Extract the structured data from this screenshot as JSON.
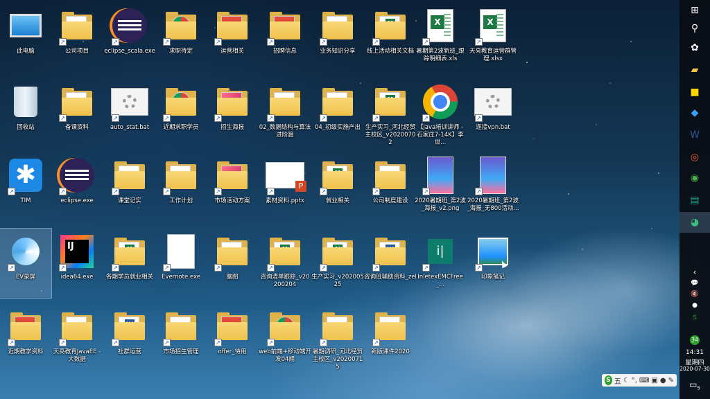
{
  "desktop": {
    "icons": [
      {
        "label": "此电脑",
        "kind": "pc"
      },
      {
        "label": "公司项目",
        "kind": "folder"
      },
      {
        "label": "eclipse_scala.exe",
        "kind": "eclipse"
      },
      {
        "label": "求职待定",
        "kind": "folder-chrome"
      },
      {
        "label": "运营相关",
        "kind": "folder-red"
      },
      {
        "label": "招聘信息",
        "kind": "folder-red"
      },
      {
        "label": "业务知识分享",
        "kind": "folder"
      },
      {
        "label": "线上活动相关文档",
        "kind": "folder-xl"
      },
      {
        "label": "暑期第2波新班_跟踪明细表.xls",
        "kind": "excel"
      },
      {
        "label": "天亮教育运营群管理.xlsx",
        "kind": "excel"
      },
      {
        "label": "回收站",
        "kind": "bin"
      },
      {
        "label": "备课资料",
        "kind": "folder"
      },
      {
        "label": "auto_stat.bat",
        "kind": "bat"
      },
      {
        "label": "近期求职学员",
        "kind": "folder-chrome"
      },
      {
        "label": "招生海报",
        "kind": "folder-pink"
      },
      {
        "label": "02_数据结构与算法进阶篇",
        "kind": "folder"
      },
      {
        "label": "04_初级实施产出",
        "kind": "folder"
      },
      {
        "label": "生产实习_河北经贸主校区_v20200702",
        "kind": "folder-xl"
      },
      {
        "label": "【java培训讲师 - 石家庄7-14K】李世...",
        "kind": "chrome"
      },
      {
        "label": "连接vpn.bat",
        "kind": "bat"
      },
      {
        "label": "TIM",
        "kind": "tim"
      },
      {
        "label": "eclipse.exe",
        "kind": "eclipse"
      },
      {
        "label": "课堂记实",
        "kind": "folder"
      },
      {
        "label": "工作计划",
        "kind": "folder"
      },
      {
        "label": "市场活动方案",
        "kind": "folder-pink"
      },
      {
        "label": "素材资料.pptx",
        "kind": "ppt"
      },
      {
        "label": "就业相关",
        "kind": "folder-xl"
      },
      {
        "label": "公司制度建设",
        "kind": "folder"
      },
      {
        "label": "2020暑期班_第2波_海报_v2.png",
        "kind": "poster"
      },
      {
        "label": "2020暑期班_第2波_海报_无800活动...",
        "kind": "poster"
      },
      {
        "label": "EV录屏",
        "kind": "ev"
      },
      {
        "label": "idea64.exe",
        "kind": "idea"
      },
      {
        "label": "各期学员就业相关",
        "kind": "folder-xl"
      },
      {
        "label": "Evernote.exe",
        "kind": "blank"
      },
      {
        "label": "脑图",
        "kind": "folder"
      },
      {
        "label": "咨询清单跟踪_v20200204",
        "kind": "folder-xl"
      },
      {
        "label": "生产实习_v20200525",
        "kind": "folder-xl"
      },
      {
        "label": "咨询班辅助资料_zel",
        "kind": "folder-wd"
      },
      {
        "label": "InletexEMCFree_...",
        "kind": "inletex"
      },
      {
        "label": "印象笔记",
        "kind": "pic"
      },
      {
        "label": "近期教学资料",
        "kind": "folder-red"
      },
      {
        "label": "天亮教育JavaEE - 大数据",
        "kind": "folder"
      },
      {
        "label": "社群运营",
        "kind": "folder-wd"
      },
      {
        "label": "市场招生管理",
        "kind": "folder"
      },
      {
        "label": "offer_待用",
        "kind": "folder-red"
      },
      {
        "label": "web前端+移动端开发04期",
        "kind": "folder-chrome"
      },
      {
        "label": "暑期调研_河北经贸主校区_v20200715",
        "kind": "folder"
      },
      {
        "label": "新版课件2020",
        "kind": "folder"
      }
    ]
  },
  "taskbar": {
    "start_icon": "windows-icon",
    "search_icon": "search-icon",
    "apps": [
      "network-icon",
      "explorer-icon",
      "sticky-notes-icon",
      "feishu-icon",
      "word-icon",
      "browser-icon",
      "chrome-icon",
      "inletex-icon",
      "app-icon"
    ],
    "tray": {
      "expand": "‹",
      "badge": "34",
      "time": "14:31",
      "weekday": "星期四",
      "date": "2020-07-30",
      "notifications_count": "5"
    }
  },
  "ime": {
    "lang": "五",
    "label": "S"
  },
  "colors": {
    "taskbar": "#0a0e14",
    "folder": "#f0c14d",
    "label_text": "#ffffff"
  }
}
